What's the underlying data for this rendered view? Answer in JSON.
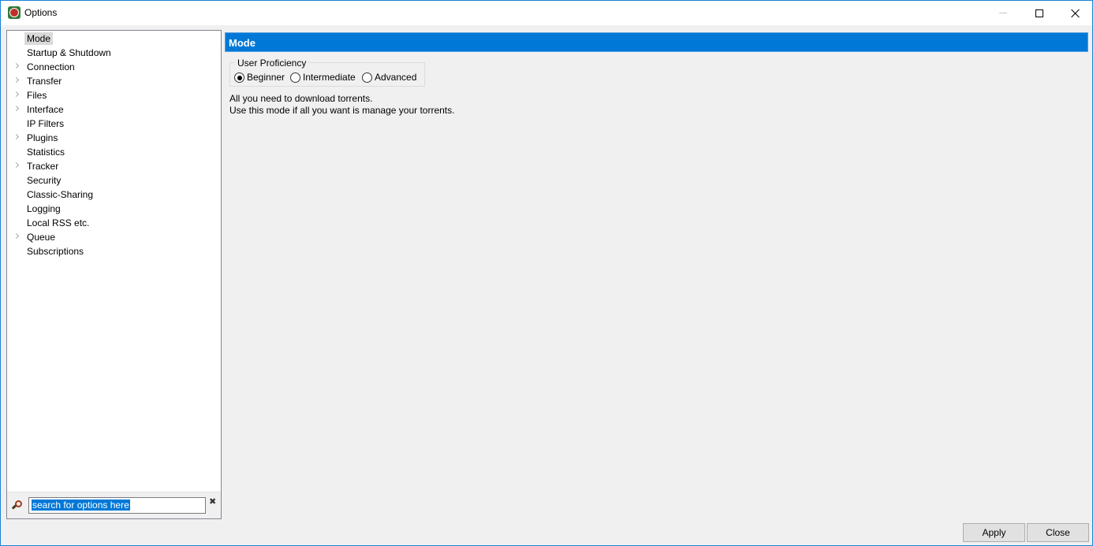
{
  "window": {
    "title": "Options",
    "accent_color": "#0078d7"
  },
  "tree": {
    "items": [
      {
        "label": "Mode",
        "expandable": false,
        "selected": true
      },
      {
        "label": "Startup & Shutdown",
        "expandable": false,
        "selected": false
      },
      {
        "label": "Connection",
        "expandable": true,
        "selected": false
      },
      {
        "label": "Transfer",
        "expandable": true,
        "selected": false
      },
      {
        "label": "Files",
        "expandable": true,
        "selected": false
      },
      {
        "label": "Interface",
        "expandable": true,
        "selected": false
      },
      {
        "label": "IP Filters",
        "expandable": false,
        "selected": false
      },
      {
        "label": "Plugins",
        "expandable": true,
        "selected": false
      },
      {
        "label": "Statistics",
        "expandable": false,
        "selected": false
      },
      {
        "label": "Tracker",
        "expandable": true,
        "selected": false
      },
      {
        "label": "Security",
        "expandable": false,
        "selected": false
      },
      {
        "label": "Classic-Sharing",
        "expandable": false,
        "selected": false
      },
      {
        "label": "Logging",
        "expandable": false,
        "selected": false
      },
      {
        "label": "Local RSS etc.",
        "expandable": false,
        "selected": false
      },
      {
        "label": "Queue",
        "expandable": true,
        "selected": false
      },
      {
        "label": "Subscriptions",
        "expandable": false,
        "selected": false
      }
    ]
  },
  "search": {
    "value": "search for options here",
    "icon": "magnifier-icon",
    "clear_icon": "clear-icon"
  },
  "content": {
    "header": "Mode",
    "group_label": "User Proficiency",
    "options": [
      {
        "label": "Beginner",
        "checked": true
      },
      {
        "label": "Intermediate",
        "checked": false
      },
      {
        "label": "Advanced",
        "checked": false
      }
    ],
    "description_line1": "All you need to download torrents.",
    "description_line2": "Use this mode if all you want is manage your torrents."
  },
  "buttons": {
    "apply": "Apply",
    "close": "Close"
  }
}
